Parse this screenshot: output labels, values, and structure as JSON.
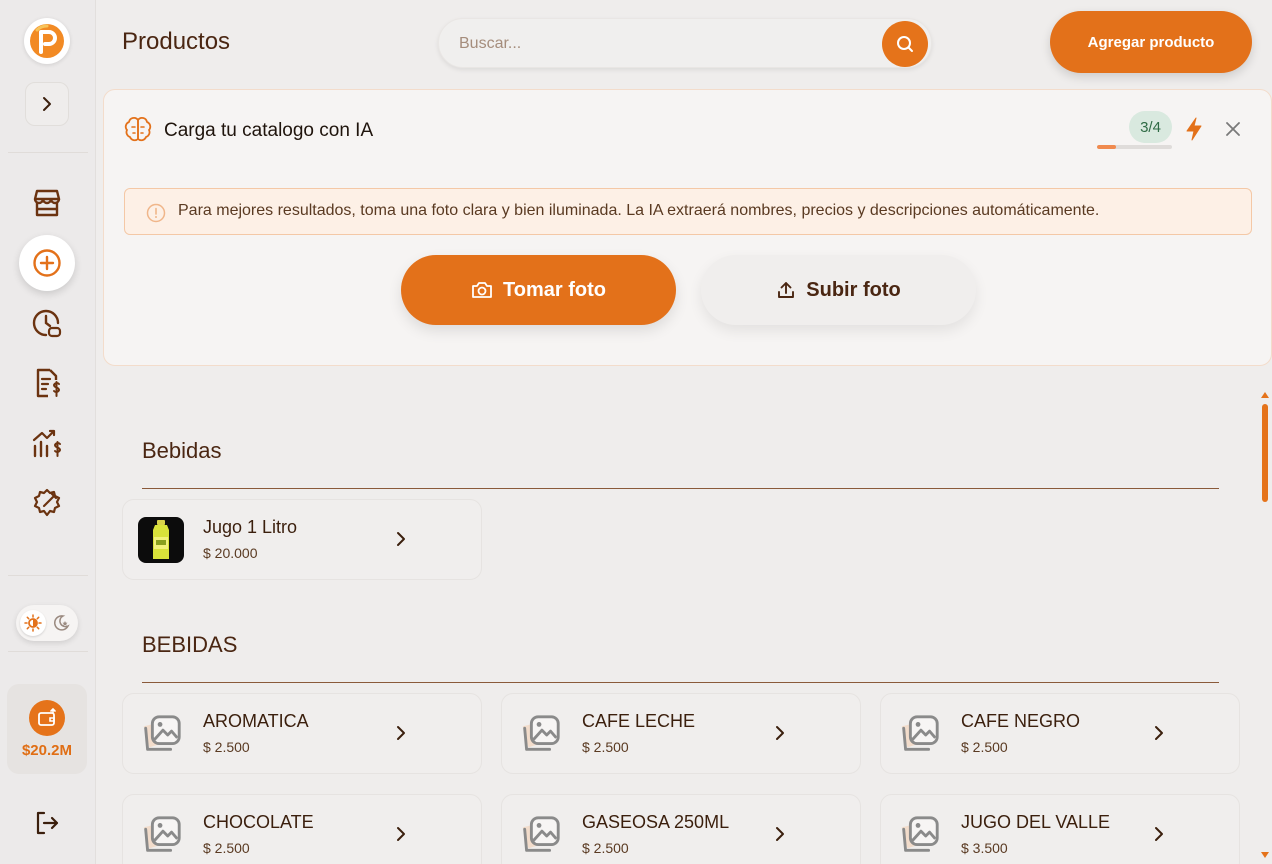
{
  "header": {
    "title": "Productos",
    "search_placeholder": "Buscar...",
    "add_button": "Agregar producto"
  },
  "sidebar": {
    "wallet_amount": "$20.2M",
    "nav_items": [
      "store-icon",
      "add-circle-icon",
      "history-icon",
      "invoice-icon",
      "sales-chart-icon",
      "settings-icon"
    ],
    "active_item": "add-circle-icon"
  },
  "ai_panel": {
    "title": "Carga tu catalogo con IA",
    "counter": "3/4",
    "progress_fraction": 0.25,
    "tip": "Para mejores resultados, toma una foto clara y bien iluminada. La IA extraerá nombres, precios y descripciones automáticamente.",
    "take_photo": "Tomar foto",
    "upload_photo": "Subir foto"
  },
  "sections": [
    {
      "title": "Bebidas",
      "products": [
        {
          "name": "Jugo 1 Litro",
          "price": "$ 20.000",
          "has_image": true
        }
      ]
    },
    {
      "title": "BEBIDAS",
      "products": [
        {
          "name": "AROMATICA",
          "price": "$ 2.500",
          "has_image": false
        },
        {
          "name": "CAFE LECHE",
          "price": "$ 2.500",
          "has_image": false
        },
        {
          "name": "CAFE NEGRO",
          "price": "$ 2.500",
          "has_image": false
        },
        {
          "name": "CHOCOLATE",
          "price": "$ 2.500",
          "has_image": false
        },
        {
          "name": "GASEOSA 250ML",
          "price": "$ 2.500",
          "has_image": false
        },
        {
          "name": "JUGO DEL VALLE",
          "price": "$ 3.500",
          "has_image": false
        }
      ]
    }
  ],
  "colors": {
    "accent": "#e3711a",
    "brown_text": "#4a2612",
    "counter_bg": "#d9e9df"
  }
}
